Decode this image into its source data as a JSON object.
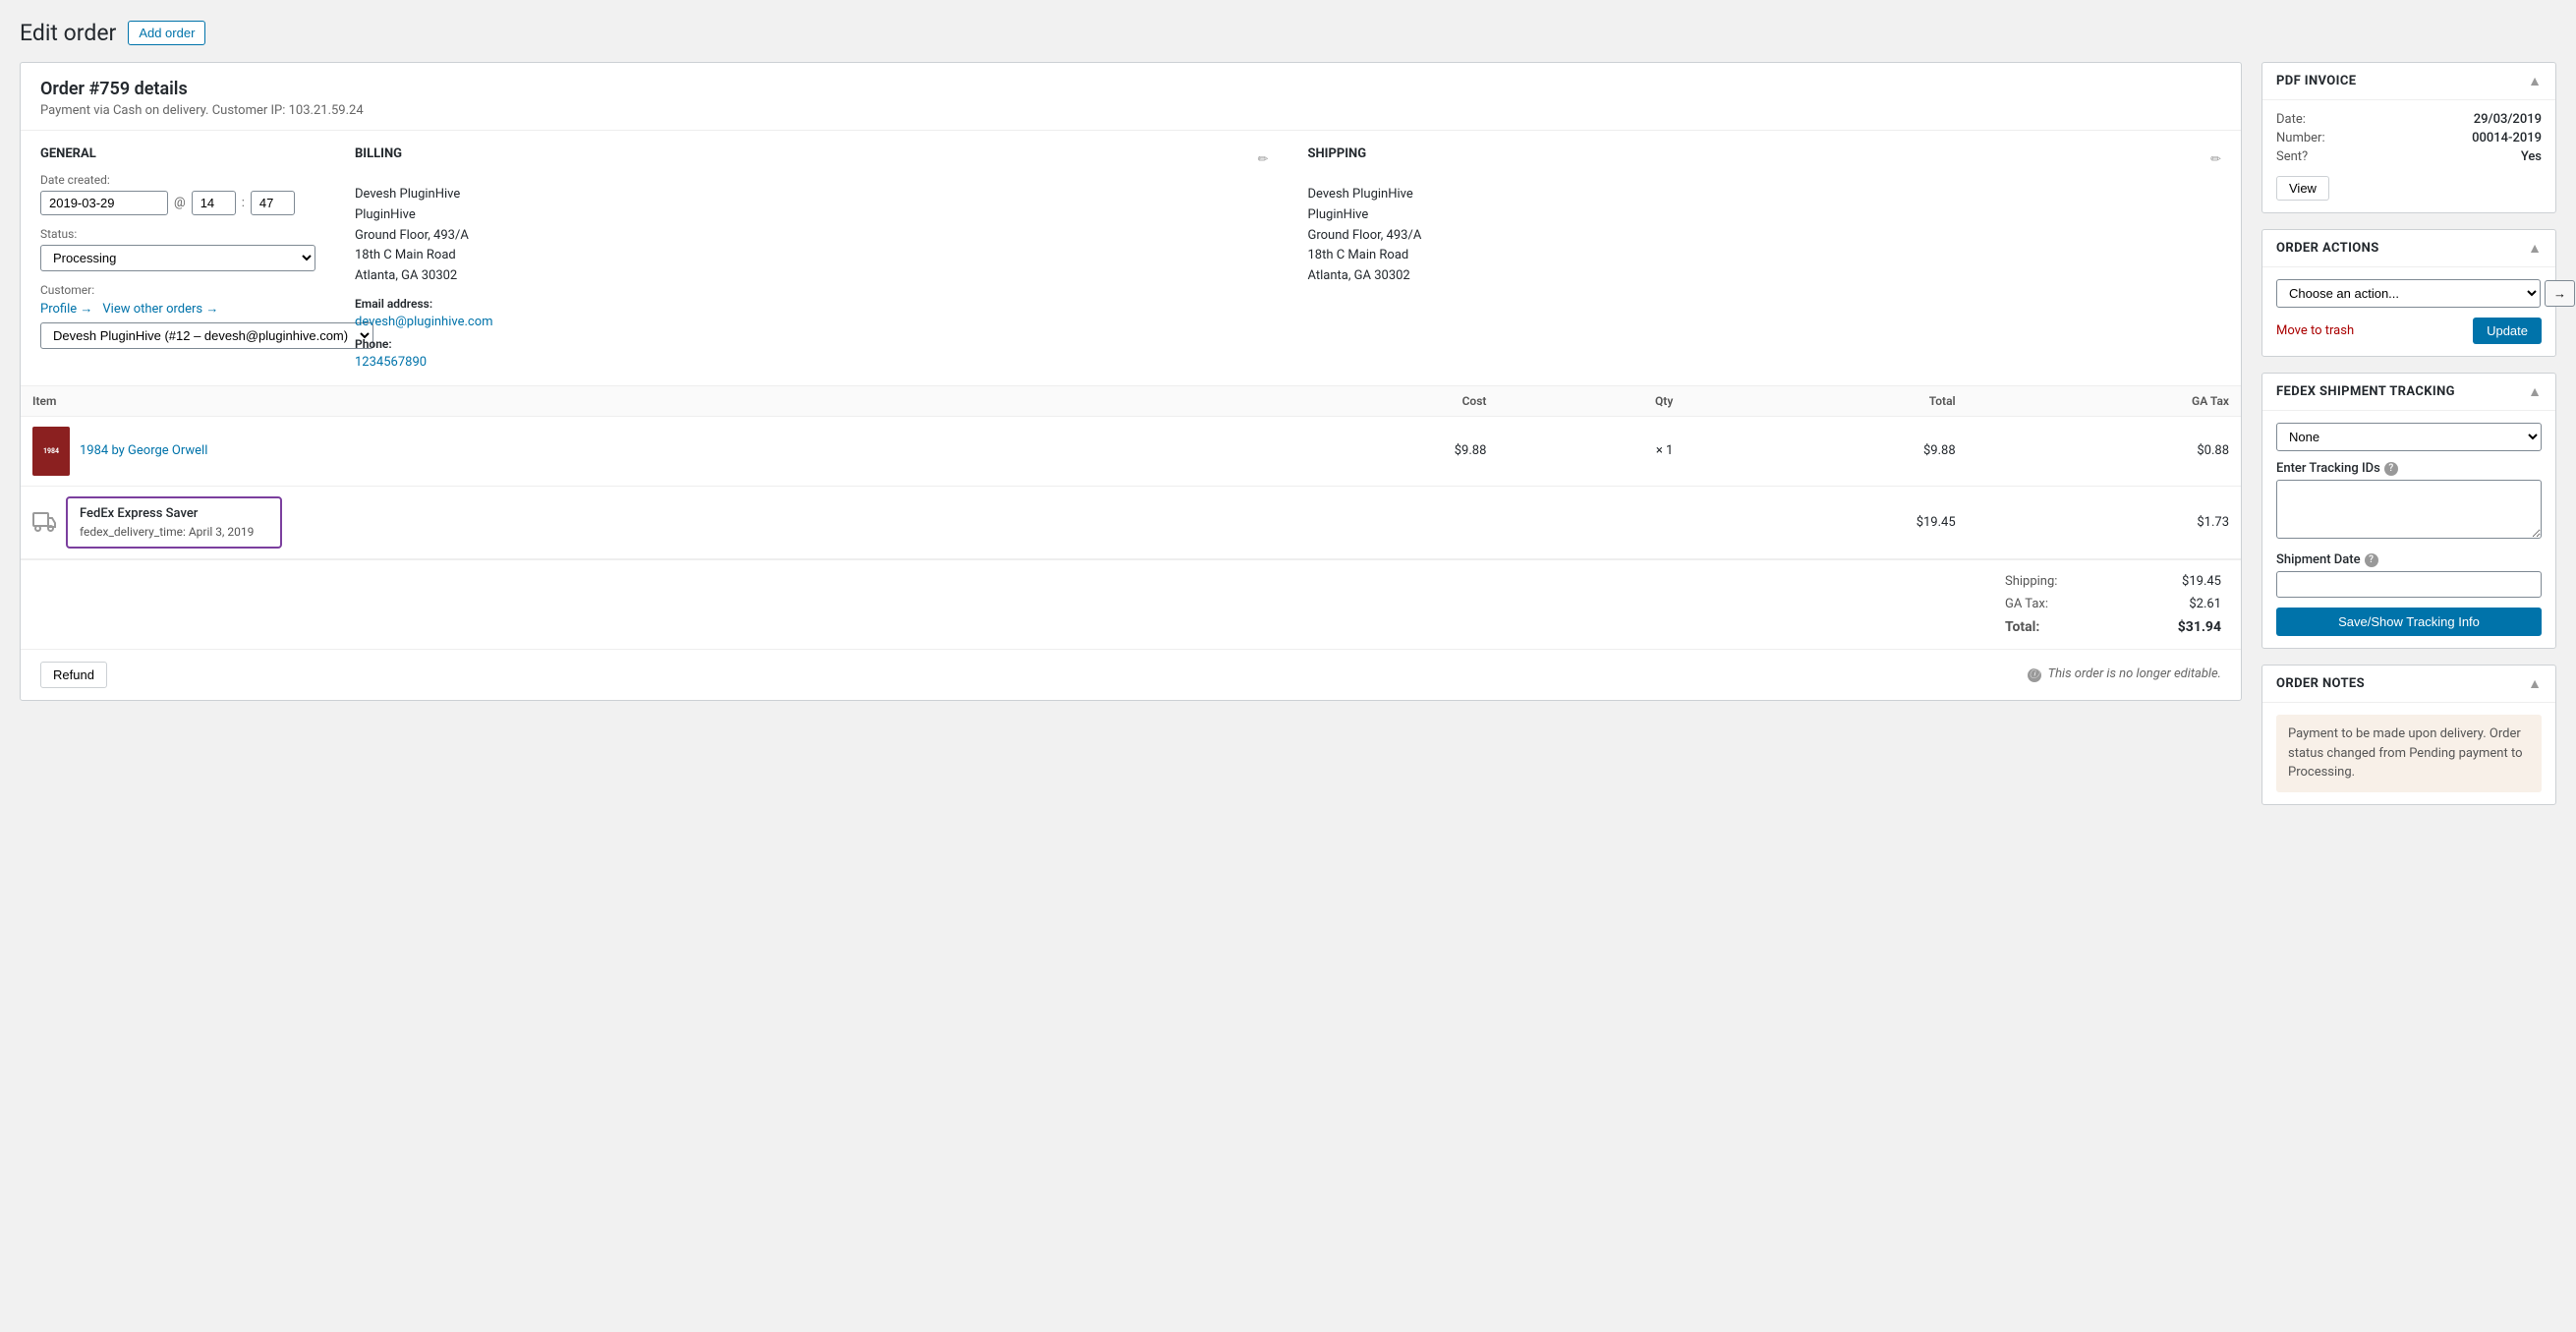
{
  "page": {
    "title": "Edit order",
    "add_order_btn": "Add order"
  },
  "order": {
    "heading": "Order #759 details",
    "payment_info": "Payment via Cash on delivery. Customer IP: 103.21.59.24",
    "general": {
      "section_title": "General",
      "date_label": "Date created:",
      "date_value": "2019-03-29",
      "time_at": "@",
      "time_hour": "14",
      "time_colon": ":",
      "time_min": "47",
      "status_label": "Status:",
      "status_value": "Processing",
      "customer_label": "Customer:",
      "profile_link": "Profile →",
      "view_other_link": "View other orders →",
      "customer_value": "Devesh PluginHive (#12 – devesh@pluginhive.com)"
    },
    "billing": {
      "section_title": "Billing",
      "name": "Devesh PluginHive",
      "company": "PluginHive",
      "address1": "Ground Floor, 493/A",
      "address2": "18th C Main Road",
      "city_state": "Atlanta, GA 30302",
      "email_label": "Email address:",
      "email": "devesh@pluginhive.com",
      "phone_label": "Phone:",
      "phone": "1234567890"
    },
    "shipping": {
      "section_title": "Shipping",
      "name": "Devesh PluginHive",
      "company": "PluginHive",
      "address1": "Ground Floor, 493/A",
      "address2": "18th C Main Road",
      "city_state": "Atlanta, GA 30302"
    },
    "items": {
      "col_item": "Item",
      "col_cost": "Cost",
      "col_qty": "Qty",
      "col_total": "Total",
      "col_ga_tax": "GA Tax",
      "rows": [
        {
          "name": "1984 by George Orwell",
          "cost": "$9.88",
          "qty": "× 1",
          "total": "$9.88",
          "ga_tax": "$0.88",
          "has_thumb": true
        }
      ],
      "shipping_row": {
        "name": "FedEx Express Saver",
        "meta_key": "fedex_delivery_time:",
        "meta_value": "April 3, 2019",
        "cost": "",
        "total": "$19.45",
        "ga_tax": "$1.73"
      }
    },
    "totals": {
      "shipping_label": "Shipping:",
      "shipping_value": "$19.45",
      "ga_tax_label": "GA Tax:",
      "ga_tax_value": "$2.61",
      "total_label": "Total:",
      "total_value": "$31.94"
    },
    "footer": {
      "refund_btn": "Refund",
      "not_editable": "This order is no longer editable."
    }
  },
  "sidebar": {
    "pdf_invoice": {
      "title": "PDF Invoice",
      "date_label": "Date:",
      "date_value": "29/03/2019",
      "number_label": "Number:",
      "number_value": "00014-2019",
      "sent_label": "Sent?",
      "sent_value": "Yes",
      "view_btn": "View"
    },
    "order_actions": {
      "title": "Order actions",
      "select_placeholder": "Choose an action...",
      "go_btn": "→",
      "move_to_trash": "Move to trash",
      "update_btn": "Update"
    },
    "fedex_tracking": {
      "title": "FedEx Shipment Tracking",
      "carrier_placeholder": "None",
      "tracking_ids_label": "Enter Tracking IDs",
      "tracking_ids_help": "?",
      "shipment_date_label": "Shipment Date",
      "shipment_date_help": "?",
      "save_btn": "Save/Show Tracking Info"
    },
    "order_notes": {
      "title": "Order notes",
      "note": "Payment to be made upon delivery. Order status changed from Pending payment to Processing."
    }
  }
}
